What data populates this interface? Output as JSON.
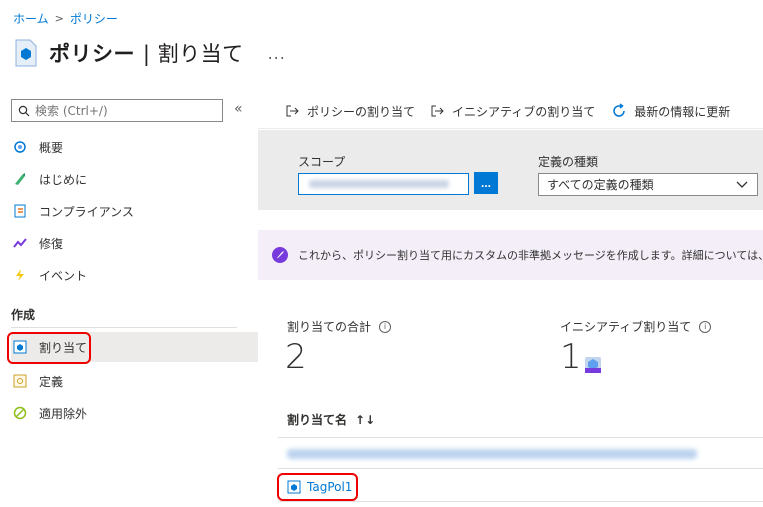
{
  "breadcrumb": {
    "home": "ホーム",
    "current": "ポリシー"
  },
  "header": {
    "title_bold": "ポリシー",
    "title_rest": "| 割り当て",
    "more": "..."
  },
  "sidebar": {
    "search_placeholder": "検索 (Ctrl+/)",
    "collapse": "«",
    "items": [
      {
        "label": "概要",
        "icon": "overview-icon"
      },
      {
        "label": "はじめに",
        "icon": "getting-started-icon"
      },
      {
        "label": "コンプライアンス",
        "icon": "compliance-icon"
      },
      {
        "label": "修復",
        "icon": "remediation-icon"
      },
      {
        "label": "イベント",
        "icon": "events-icon"
      }
    ],
    "section": "作成",
    "authoring": [
      {
        "label": "割り当て",
        "icon": "assignments-icon",
        "selected": true
      },
      {
        "label": "定義",
        "icon": "definitions-icon"
      },
      {
        "label": "適用除外",
        "icon": "exemptions-icon"
      }
    ]
  },
  "toolbar": {
    "assign_policy": "ポリシーの割り当て",
    "assign_initiative": "イニシアティブの割り当て",
    "refresh": "最新の情報に更新"
  },
  "filters": {
    "scope_label": "スコープ",
    "scope_button": "...",
    "definition_type_label": "定義の種類",
    "definition_type_value": "すべての定義の種類"
  },
  "banner": {
    "text": "これから、ポリシー割り当て用にカスタムの非準拠メッセージを作成します。詳細については、https://aka.ms"
  },
  "stats": {
    "total_label": "割り当ての合計",
    "total_value": "2",
    "initiative_label": "イニシアティブ割り当て",
    "initiative_value": "1"
  },
  "table": {
    "column_name": "割り当て名",
    "sort_icon": "↑↓",
    "rows": [
      {
        "name": "TagPol1"
      }
    ]
  },
  "colors": {
    "accent": "#0078d4",
    "highlight": "#e00000",
    "selected_bg": "#edebe9"
  }
}
